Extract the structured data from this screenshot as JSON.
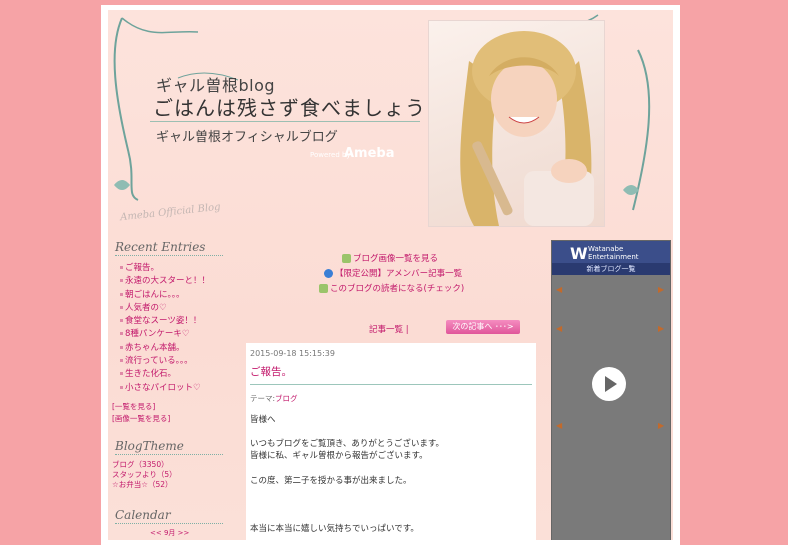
{
  "header": {
    "blog_name": "ギャル曽根blog",
    "blog_title": "ごはんは残さず食べましょう",
    "official": "ギャル曽根オフィシャルブログ",
    "powered_by": "Powered by",
    "ameba": "Ameba",
    "ameba_official": "Ameba Official Blog"
  },
  "sidebar": {
    "recent_heading": "Recent Entries",
    "entries": [
      "ご報告。",
      "永遠の大スターと！！",
      "朝ごはんに。。。",
      "人気者の♡",
      "食堂なスーツ姿！！",
      "8種パンケーキ♡",
      "赤ちゃん本舗。",
      "流行っている。。。",
      "生きた化石。",
      "小さなパイロット♡"
    ],
    "list_link": "[一覧を見る]",
    "image_link": "[画像一覧を見る]",
    "theme_heading": "BlogTheme",
    "themes": [
      "ブログ（3350）",
      "スタッフより（5）",
      "☆お弁当☆（52）"
    ],
    "calendar_heading": "Calendar",
    "calendar_nav": "<< 9月 >>"
  },
  "main": {
    "link_images": "ブログ画像一覧を見る",
    "link_members": "【限定公開】アメンバー記事一覧",
    "link_reader": "このブログの読者になる(チェック)",
    "list_label": "記事一覧 |",
    "next_label": "次の記事へ ･･･>",
    "article": {
      "date": "2015-09-18 15:15:39",
      "title": "ご報告。",
      "theme_label": "テーマ:",
      "theme_value": "ブログ",
      "body": [
        "皆様へ",
        "",
        "いつもブログをご覧頂き、ありがとうございます。",
        "皆様に私、ギャル曽根から報告がございます。",
        "",
        "この度、第二子を授かる事が出来ました。",
        "",
        "",
        "",
        "本当に本当に嬉しい気持ちでいっぱいです。"
      ]
    }
  },
  "right": {
    "logo": "Watanabe Entertainment",
    "sub": "新着ブログ一覧"
  },
  "colors": {
    "background": "#f6a3a6",
    "link": "#c2186b",
    "accent": "#7fb0a6"
  }
}
